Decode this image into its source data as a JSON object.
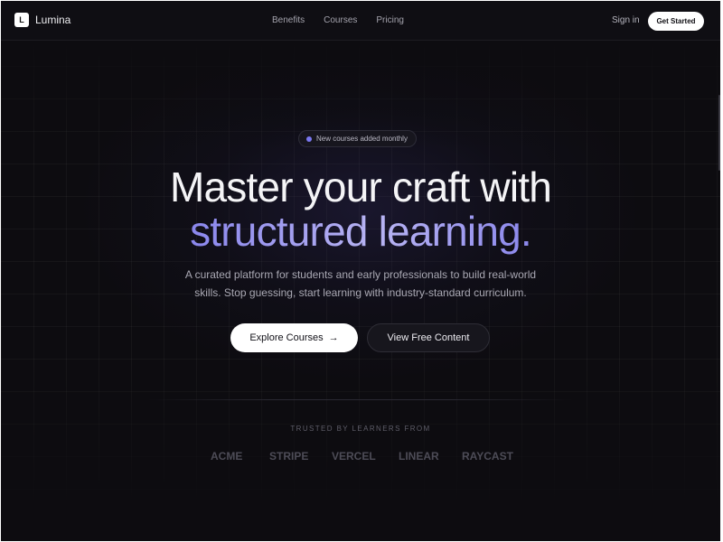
{
  "nav": {
    "brand_initial": "L",
    "brand_name": "Lumina",
    "links": [
      "Benefits",
      "Courses",
      "Pricing"
    ],
    "sign_in": "Sign in",
    "cta": "Get Started"
  },
  "hero": {
    "badge": "New courses added monthly",
    "headline_line1": "Master your craft with",
    "headline_line2": "structured learning.",
    "subtitle_line1": "A curated platform for students and early professionals to build real-world",
    "subtitle_line2": "skills. Stop guessing, start learning with industry-standard curriculum.",
    "primary_button": "Explore Courses",
    "primary_arrow": "→",
    "secondary_button": "View Free Content"
  },
  "trusted": {
    "label": "TRUSTED BY LEARNERS FROM",
    "logos": [
      "ACME",
      "STRIPE",
      "VERCEL",
      "LINEAR",
      "RAYCAST"
    ]
  },
  "colors": {
    "background": "#0d0c10",
    "accent": "#8a86ec",
    "badge_dot": "#7a78f0"
  }
}
